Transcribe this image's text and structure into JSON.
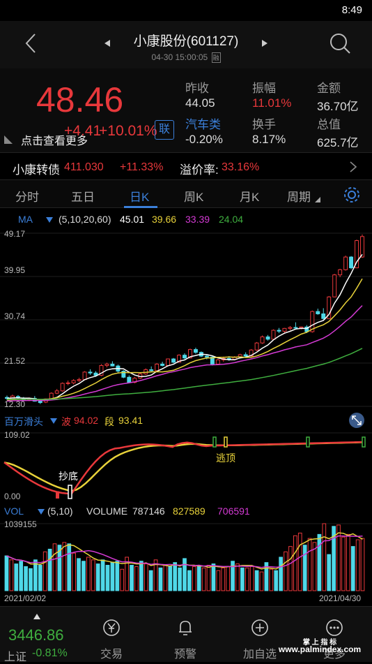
{
  "status": {
    "time": "8:49"
  },
  "header": {
    "title": "小康股份(601127)",
    "subtitle": "04-30 15:00:05",
    "subtitle_badge": "融"
  },
  "quote": {
    "price": "48.46",
    "change": "+4.41",
    "change_pct": "+10.01%",
    "badge": "联",
    "more_text": "点击查看更多",
    "stats": [
      {
        "label": "昨收",
        "value": "44.05"
      },
      {
        "label": "振幅",
        "value": "11.01%"
      },
      {
        "label": "金额",
        "value": "36.70亿"
      },
      {
        "label": "汽车类",
        "value": "-0.20%"
      },
      {
        "label": "换手",
        "value": "8.17%"
      },
      {
        "label": "总值",
        "value": "625.7亿"
      }
    ]
  },
  "bond": {
    "name": "小康转债",
    "price": "411.030",
    "change_pct": "+11.33%",
    "premium_label": "溢价率:",
    "premium_value": "33.16%"
  },
  "tabs": [
    "分时",
    "五日",
    "日K",
    "周K",
    "月K",
    "周期"
  ],
  "ma": {
    "label": "MA",
    "params": "(5,10,20,60)",
    "v1": "45.01",
    "v2": "39.66",
    "v3": "33.39",
    "v4": "24.04"
  },
  "price_axis": [
    "49.17",
    "39.95",
    "30.74",
    "21.52",
    "12.30"
  ],
  "indicator": {
    "name": "百万滑头",
    "wave_label": "波",
    "wave_value": "94.02",
    "seg_label": "段",
    "seg_value": "93.41",
    "top": "109.02",
    "bottom": "0.00",
    "buy_label": "抄底",
    "sell_label": "逃顶"
  },
  "volume": {
    "label": "VOL",
    "params": "(5,10)",
    "vol_label": "VOLUME",
    "vol_value": "787146",
    "ma5": "827589",
    "ma10": "706591",
    "max": "1039155",
    "start_date": "2021/02/02",
    "end_date": "2021/04/30"
  },
  "bottom": {
    "index_value": "3446.86",
    "index_name": "上证",
    "index_change": "-0.81%",
    "nav": [
      "交易",
      "预警",
      "加自选",
      "更多"
    ],
    "watermark_line1": "掌 上 指 标",
    "watermark_line2": "www.palmindex.com"
  },
  "colors": {
    "red": "#e8383b",
    "cyan": "#4fd8e8",
    "yellow": "#e8d23a",
    "magenta": "#d43ad4",
    "green": "#3fae3f",
    "blue": "#3b7fd9"
  },
  "chart_data": {
    "type": "candlestick",
    "ylim": [
      12.3,
      49.17
    ],
    "candles": [
      [
        14.2,
        14.6,
        13.6,
        14.0
      ],
      [
        13.9,
        14.8,
        13.7,
        14.5
      ],
      [
        14.4,
        14.7,
        13.9,
        14.1
      ],
      [
        14.0,
        14.3,
        13.5,
        13.6
      ],
      [
        13.7,
        14.2,
        13.4,
        14.0
      ],
      [
        14.0,
        14.5,
        13.3,
        13.4
      ],
      [
        13.4,
        13.8,
        12.8,
        13.1
      ],
      [
        13.2,
        14.0,
        13.0,
        13.9
      ],
      [
        13.9,
        15.3,
        13.8,
        15.1
      ],
      [
        15.1,
        16.0,
        14.9,
        15.6
      ],
      [
        15.6,
        17.4,
        15.4,
        17.2
      ],
      [
        17.2,
        17.8,
        16.8,
        17.3
      ],
      [
        17.3,
        18.1,
        17.0,
        17.8
      ],
      [
        17.8,
        18.4,
        17.5,
        18.0
      ],
      [
        18.0,
        19.8,
        17.9,
        19.6
      ],
      [
        19.6,
        20.2,
        19.0,
        19.4
      ],
      [
        19.4,
        19.8,
        18.6,
        18.9
      ],
      [
        18.9,
        21.3,
        18.7,
        21.0
      ],
      [
        21.0,
        21.6,
        20.6,
        21.3
      ],
      [
        21.3,
        21.9,
        20.8,
        20.9
      ],
      [
        20.9,
        21.2,
        19.5,
        19.8
      ],
      [
        19.8,
        20.0,
        18.3,
        18.5
      ],
      [
        18.5,
        18.9,
        17.2,
        17.4
      ],
      [
        17.4,
        18.6,
        17.2,
        18.3
      ],
      [
        18.3,
        19.4,
        18.1,
        19.2
      ],
      [
        19.2,
        20.4,
        19.0,
        20.1
      ],
      [
        20.1,
        20.8,
        19.6,
        19.9
      ],
      [
        19.9,
        21.5,
        19.8,
        21.3
      ],
      [
        21.3,
        21.8,
        20.8,
        21.0
      ],
      [
        21.0,
        22.5,
        20.9,
        22.4
      ],
      [
        22.4,
        22.6,
        21.5,
        21.7
      ],
      [
        21.7,
        23.4,
        21.6,
        23.2
      ],
      [
        23.2,
        23.6,
        22.4,
        22.6
      ],
      [
        22.6,
        24.6,
        22.5,
        24.4
      ],
      [
        24.4,
        24.8,
        23.5,
        23.8
      ],
      [
        23.8,
        24.0,
        22.8,
        23.0
      ],
      [
        23.0,
        23.4,
        22.3,
        22.8
      ],
      [
        22.8,
        23.1,
        21.0,
        21.3
      ],
      [
        21.3,
        22.4,
        21.2,
        22.2
      ],
      [
        22.2,
        22.9,
        21.8,
        22.5
      ],
      [
        22.5,
        23.0,
        22.0,
        22.3
      ],
      [
        22.3,
        23.0,
        22.1,
        22.8
      ],
      [
        22.8,
        23.5,
        22.6,
        23.3
      ],
      [
        23.3,
        23.8,
        22.8,
        23.0
      ],
      [
        23.0,
        24.5,
        22.9,
        24.3
      ],
      [
        24.3,
        26.0,
        24.1,
        25.8
      ],
      [
        25.8,
        27.4,
        25.6,
        27.1
      ],
      [
        27.1,
        27.5,
        26.3,
        26.6
      ],
      [
        26.6,
        28.7,
        26.5,
        28.5
      ],
      [
        28.5,
        29.0,
        27.9,
        28.3
      ],
      [
        28.3,
        29.0,
        27.8,
        28.9
      ],
      [
        28.9,
        29.4,
        28.5,
        29.1
      ],
      [
        29.1,
        30.2,
        28.9,
        29.0
      ],
      [
        29.0,
        29.3,
        28.7,
        29.2
      ],
      [
        29.2,
        29.6,
        27.9,
        28.2
      ],
      [
        28.2,
        32.7,
        28.0,
        32.5
      ],
      [
        32.5,
        33.1,
        31.8,
        32.0
      ],
      [
        32.0,
        33.2,
        30.8,
        31.0
      ],
      [
        31.0,
        35.8,
        30.9,
        35.6
      ],
      [
        35.6,
        40.5,
        35.5,
        40.3
      ],
      [
        40.3,
        41.6,
        39.8,
        41.4
      ],
      [
        41.4,
        44.4,
        41.2,
        44.1
      ],
      [
        44.1,
        44.3,
        41.5,
        41.8
      ],
      [
        41.8,
        47.8,
        41.7,
        47.6
      ],
      [
        44.1,
        48.9,
        43.9,
        48.46
      ]
    ],
    "ma_series": [
      {
        "name": "MA5",
        "color": "#ffffff"
      },
      {
        "name": "MA10",
        "color": "#e8d23a"
      },
      {
        "name": "MA20",
        "color": "#d43ad4"
      },
      {
        "name": "MA60",
        "color": "#3fae3f"
      }
    ],
    "volumes": [
      52,
      46,
      40,
      44,
      36,
      33,
      46,
      38,
      58,
      62,
      70,
      68,
      72,
      70,
      56,
      48,
      44,
      50,
      46,
      40,
      46,
      38,
      42,
      44,
      32,
      50,
      38,
      36,
      44,
      40,
      30,
      46,
      34,
      38,
      36,
      42,
      34,
      48,
      30,
      36,
      36,
      34,
      38,
      40,
      30,
      34,
      36,
      44,
      40,
      34,
      34,
      36,
      30,
      28,
      42,
      32,
      30,
      50,
      58,
      66,
      82,
      86,
      68,
      78,
      72,
      84,
      100,
      54,
      96,
      98,
      80,
      84,
      66,
      76,
      78
    ],
    "vol_ylim": [
      0,
      1039155
    ]
  }
}
